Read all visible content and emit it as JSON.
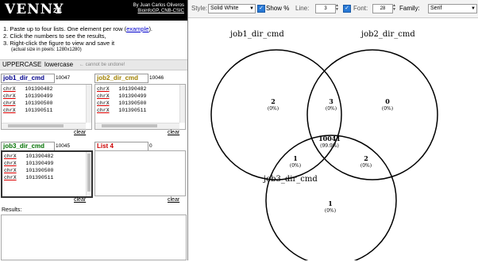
{
  "header": {
    "logo": "VENNY",
    "version": "2.1",
    "author_line1": "By Juan Carlos Oliveros",
    "author_line2": "BioinfoGP, CNB-CSIC"
  },
  "instructions": {
    "step1_prefix": "1. Paste up to four lists. One element per row (",
    "step1_link": "example",
    "step1_suffix": ").",
    "step2": "2. Click the numbers to see the results,",
    "step3": "3. Right-click the figure to view and save it",
    "note": "(actual size in pixels: 1280x1280)"
  },
  "casebar": {
    "upper": "UPPERCASE",
    "lower": "lowercase",
    "note": "← cannot be undone!"
  },
  "lists": [
    {
      "name": "job1_dir_cmd",
      "count": "10047",
      "color": "#00008b",
      "rows": [
        {
          "a": "chrX",
          "b": "101390482"
        },
        {
          "a": "chrX",
          "b": "101390499"
        },
        {
          "a": "chrX",
          "b": "101390500"
        },
        {
          "a": "chrX",
          "b": "101390511"
        }
      ],
      "clear": "clear"
    },
    {
      "name": "job2_dir_cmd",
      "count": "10046",
      "color": "#a08000",
      "rows": [
        {
          "a": "chrX",
          "b": "101390482"
        },
        {
          "a": "chrX",
          "b": "101390499"
        },
        {
          "a": "chrX",
          "b": "101390500"
        },
        {
          "a": "chrX",
          "b": "101390511"
        }
      ],
      "clear": "clear"
    },
    {
      "name": "job3_dir_cmd",
      "count": "10045",
      "color": "#007000",
      "rows": [
        {
          "a": "chrX",
          "b": "101390482"
        },
        {
          "a": "chrX",
          "b": "101390499"
        },
        {
          "a": "chrX",
          "b": "101390500"
        },
        {
          "a": "chrX",
          "b": "101390511"
        }
      ],
      "clear": "clear"
    },
    {
      "name": "List 4",
      "count": "0",
      "color": "#cc0000",
      "rows": [],
      "clear": "clear"
    }
  ],
  "results": {
    "label": "Results:"
  },
  "toolbar": {
    "style_label": "Style:",
    "style_value": "Solid White",
    "show_pct_label": "Show %",
    "line_label": "Line:",
    "line_value": "3",
    "font_label": "Font:",
    "font_value": "28",
    "family_label": "Family:",
    "family_value": "Serif"
  },
  "venn": {
    "label_a": "job1_dir_cmd",
    "label_b": "job2_dir_cmd",
    "label_c": "job3_dir_cmd",
    "only_a": "2",
    "only_a_pct": "(0%)",
    "ab": "3",
    "ab_pct": "(0%)",
    "only_b": "0",
    "only_b_pct": "(0%)",
    "abc": "10041",
    "abc_pct": "(99.9%)",
    "ac": "1",
    "ac_pct": "(0%)",
    "bc": "2",
    "bc_pct": "(0%)",
    "only_c": "1",
    "only_c_pct": "(0%)"
  }
}
